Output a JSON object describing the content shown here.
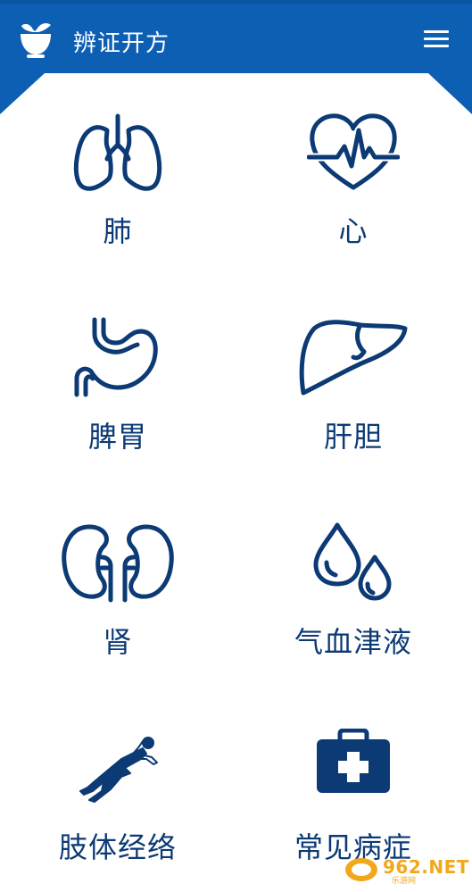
{
  "header": {
    "title": "辨证开方",
    "menu_icon": "hamburger-menu-icon",
    "logo_icon": "herb-bowl-logo-icon",
    "color": "#0d5fb4"
  },
  "categories": [
    {
      "label": "肺",
      "icon": "lungs-icon"
    },
    {
      "label": "心",
      "icon": "heart-pulse-icon"
    },
    {
      "label": "脾胃",
      "icon": "stomach-icon"
    },
    {
      "label": "肝胆",
      "icon": "liver-icon"
    },
    {
      "label": "肾",
      "icon": "kidneys-icon"
    },
    {
      "label": "气血津液",
      "icon": "water-drops-icon"
    },
    {
      "label": "肢体经络",
      "icon": "human-body-icon"
    },
    {
      "label": "常见病症",
      "icon": "medical-kit-icon"
    }
  ],
  "watermark": {
    "text": "962.NET",
    "sub": "乐游网"
  },
  "colors": {
    "accent": "#0d5fb4",
    "icon": "#0c3a75",
    "watermark": "#f2a81b"
  }
}
